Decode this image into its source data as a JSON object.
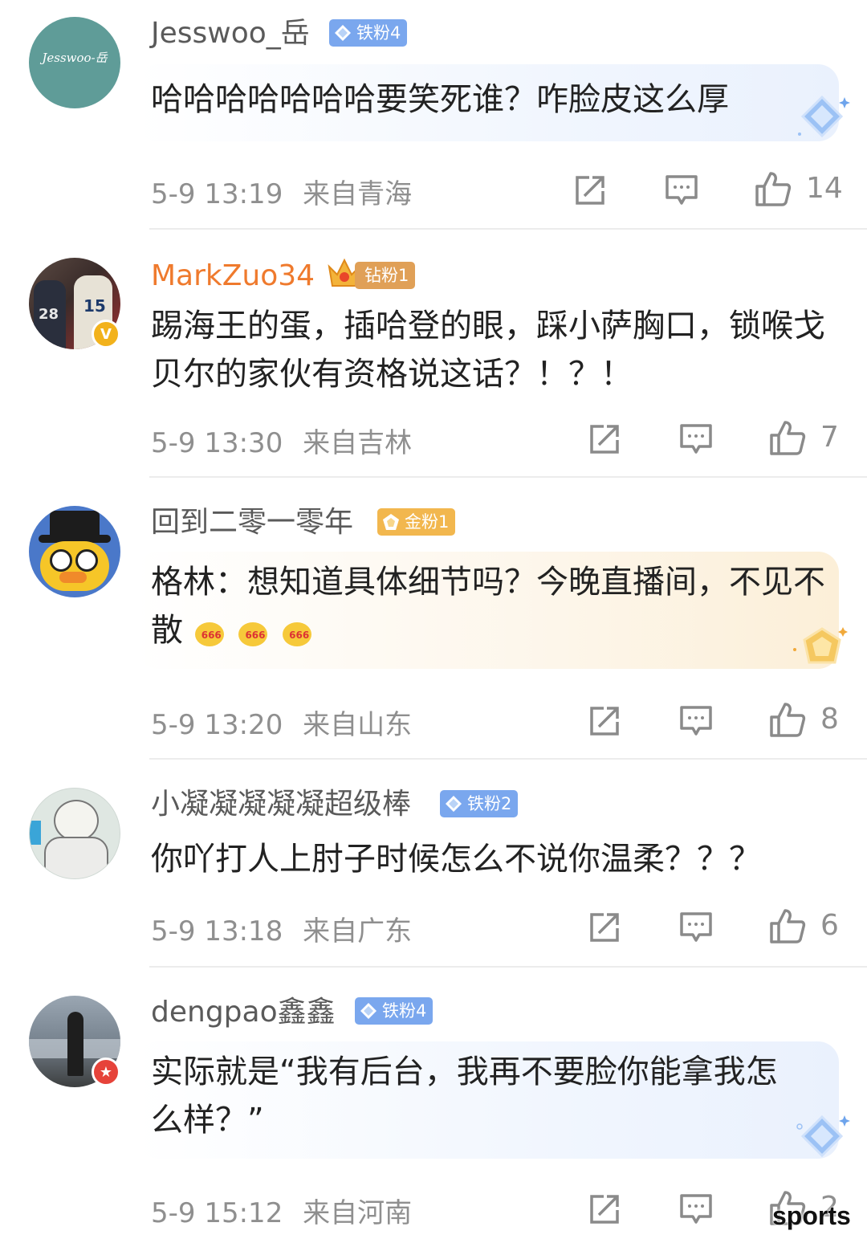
{
  "comments": [
    {
      "username": "Jesswoo_岳",
      "badge": "铁粉4",
      "avatar_text": "Jesswoo-岳",
      "text": "哈哈哈哈哈哈哈要笑死谁？咋脸皮这么厚",
      "time": "5-9 13:19",
      "location": "来自青海",
      "likes": "14"
    },
    {
      "username": "MarkZuo34",
      "badge": "钻粉1",
      "avatar_jerseys": [
        "28",
        "15"
      ],
      "text": "踢海王的蛋，插哈登的眼，踩小萨胸口，锁喉戈贝尔的家伙有资格说这话？！？！",
      "time": "5-9 13:30",
      "location": "来自吉林",
      "likes": "7"
    },
    {
      "username": "回到二零一零年",
      "badge": "金粉1",
      "text": "格林：想知道具体细节吗？今晚直播间，不见不散",
      "emoji_label": "666",
      "time": "5-9 13:20",
      "location": "来自山东",
      "likes": "8"
    },
    {
      "username": "小凝凝凝凝凝超级棒",
      "badge": "铁粉2",
      "text": "你吖打人上肘子时候怎么不说你温柔？？？",
      "time": "5-9 13:18",
      "location": "来自广东",
      "likes": "6"
    },
    {
      "username": "dengpao鑫鑫",
      "badge": "铁粉4",
      "text": "实际就是“我有后台，我再不要脸你能拿我怎么样？”",
      "time": "5-9 15:12",
      "location": "来自河南",
      "likes": "2"
    }
  ],
  "icons": {
    "share": "share-icon",
    "comment": "comment-icon",
    "like": "like-icon",
    "verified": "verified-badge-icon"
  },
  "watermark": "sports",
  "colors": {
    "iron_badge": "#7aa7ee",
    "diamond_badge": "#e0a057",
    "gold_badge": "#f2b74e",
    "gold_username": "#ef7a2d",
    "meta_gray": "#8f8f8f"
  }
}
